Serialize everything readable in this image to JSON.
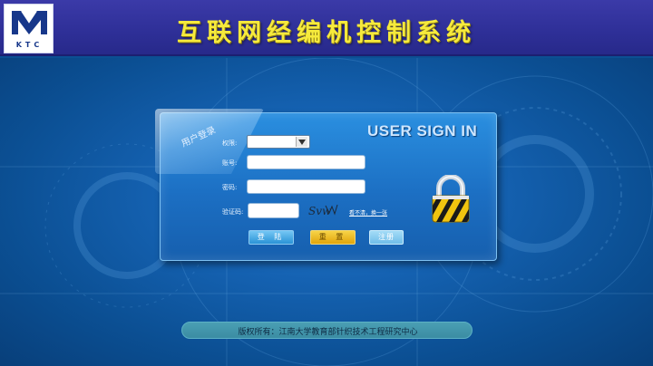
{
  "header": {
    "title": "互联网经编机控制系统",
    "logo_text": "KTC"
  },
  "login": {
    "tab_label": "用户登录",
    "heading": "USER SIGN IN",
    "role_label": "权限:",
    "role_value": "",
    "account_label": "账号:",
    "account_value": "",
    "password_label": "密码:",
    "password_value": "",
    "captcha_label": "验证码:",
    "captcha_value": "",
    "captcha_image_text": "Svw",
    "refresh_link": "看不清，换一张",
    "login_button": "登 陆",
    "reset_button": "重 置",
    "register_button": "注册"
  },
  "footer": {
    "copyright": "版权所有：江南大学教育部针织技术工程研究中心"
  },
  "colors": {
    "header_bg": "#2e2f97",
    "title": "#f6ea3c",
    "background": "#0b4f93",
    "panel": "#1c6fc3",
    "login_button": "#2a93d6",
    "reset_button": "#e1a50b",
    "register_button": "#6fbde9",
    "footer_bar": "#3b8ca3"
  },
  "icons": [
    "ktc-logo-icon",
    "padlock-icon",
    "dropdown-arrow-icon"
  ]
}
